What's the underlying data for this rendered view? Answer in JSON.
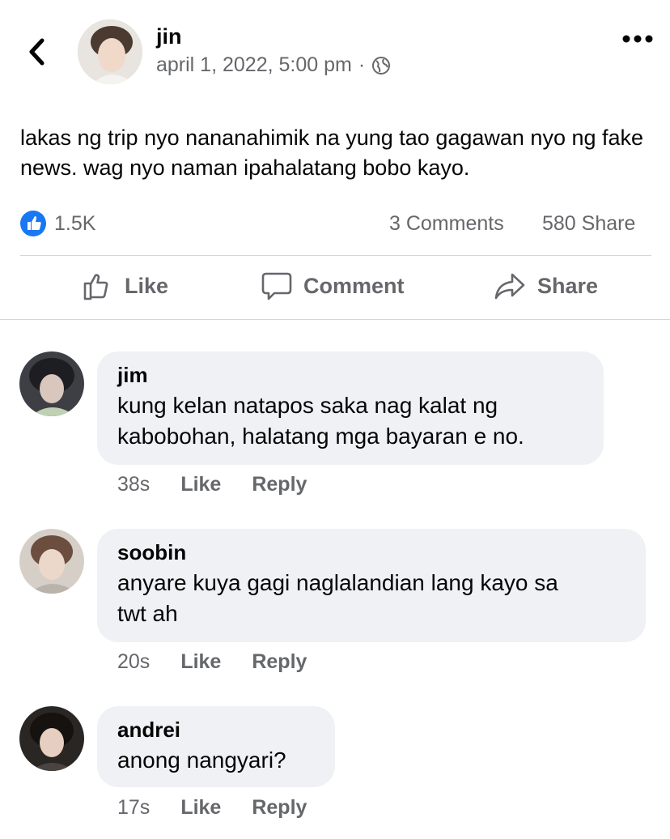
{
  "post": {
    "author": "jin",
    "timestamp": "april 1, 2022, 5:00 pm",
    "meta_separator": "·",
    "privacy_icon": "globe-icon",
    "text": "lakas ng trip nyo nananahimik na yung tao gagawan nyo ng fake news. wag nyo naman ipahalatang bobo kayo."
  },
  "stats": {
    "reactions": "1.5K",
    "comments": "3 Comments",
    "shares": "580 Share"
  },
  "actions": {
    "like": "Like",
    "comment": "Comment",
    "share": "Share"
  },
  "comments": [
    {
      "name": "jim",
      "text": "kung kelan natapos saka nag kalat ng\nkabobohan, halatang mga bayaran e no.",
      "time": "38s",
      "like": "Like",
      "reply": "Reply"
    },
    {
      "name": "soobin",
      "text": "anyare kuya gagi naglalandian lang kayo sa\ntwt ah",
      "time": "20s",
      "like": "Like",
      "reply": "Reply"
    },
    {
      "name": "andrei",
      "text": "anong nangyari?",
      "time": "17s",
      "like": "Like",
      "reply": "Reply"
    }
  ],
  "colors": {
    "accent_blue": "#1877f2",
    "secondary_text": "#65676b",
    "bubble_bg": "#f0f1f4"
  }
}
